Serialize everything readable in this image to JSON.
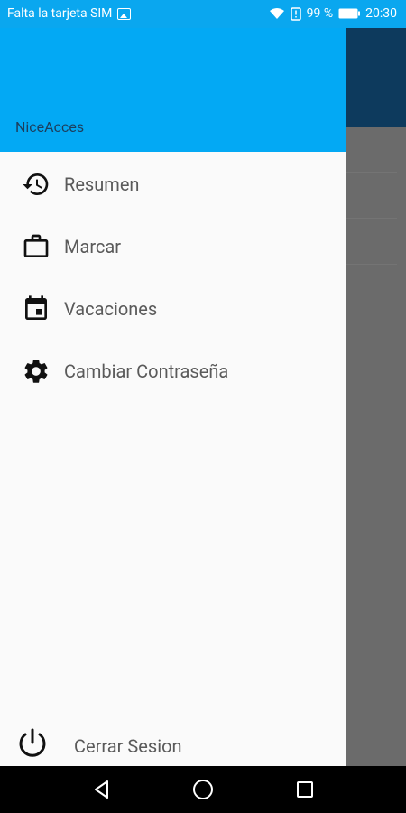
{
  "status_bar": {
    "carrier": "Falta la tarjeta SIM",
    "battery": "99 %",
    "time": "20:30"
  },
  "drawer": {
    "app_name": "NiceAcces",
    "items": [
      {
        "label": "Resumen",
        "icon": "history-icon"
      },
      {
        "label": "Marcar",
        "icon": "briefcase-icon"
      },
      {
        "label": "Vacaciones",
        "icon": "calendar-icon"
      },
      {
        "label": "Cambiar Contraseña",
        "icon": "gear-icon"
      }
    ],
    "logout_label": "Cerrar Sesion"
  },
  "colors": {
    "status_bar": "#0aa7ef",
    "drawer_header": "#03a9f4",
    "background_appbar": "#0d3a5d"
  }
}
